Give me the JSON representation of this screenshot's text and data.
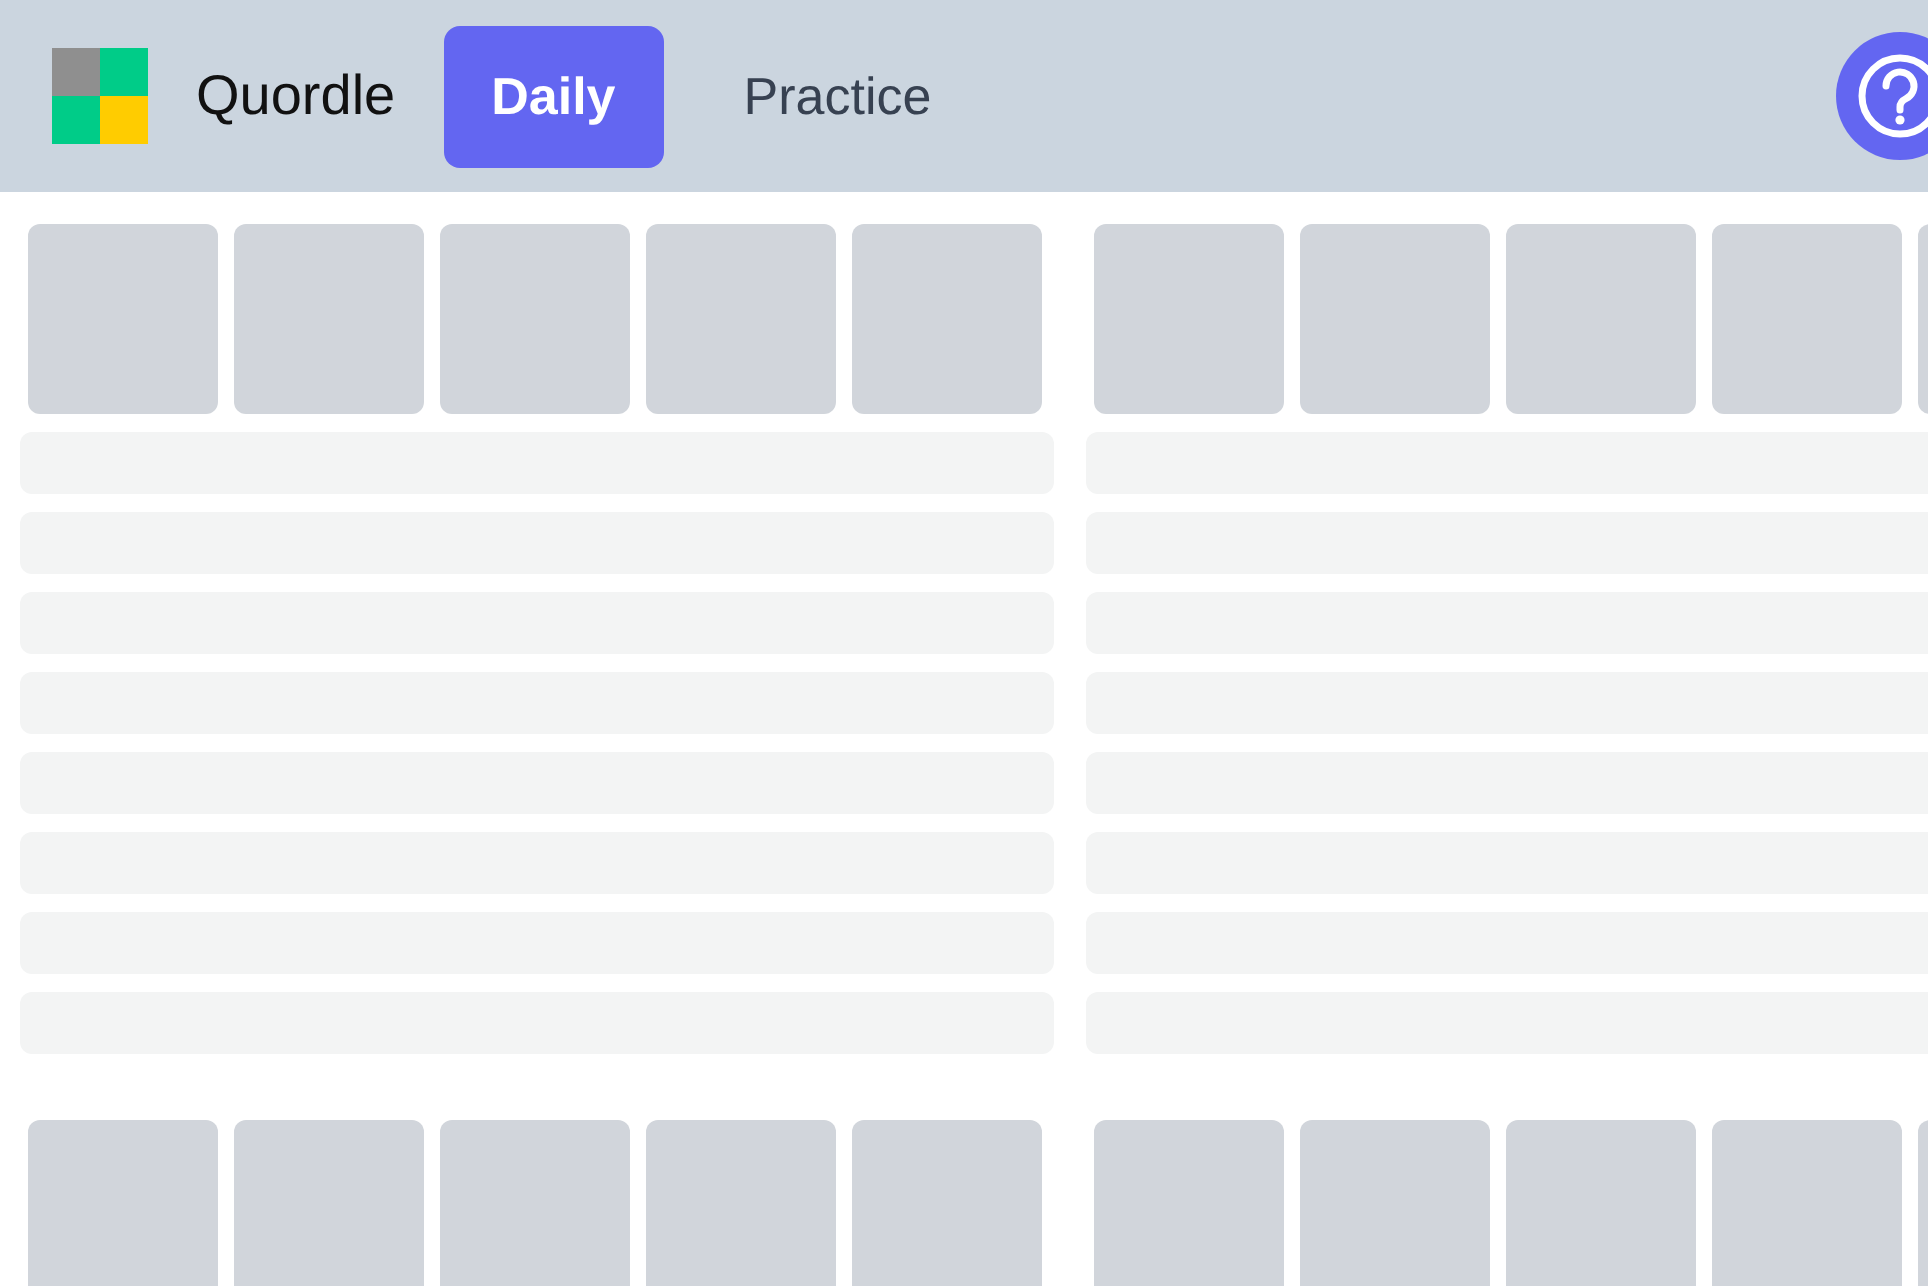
{
  "header": {
    "logo": {
      "kind": "grid"
    },
    "title": "Quordle",
    "tabs": [
      {
        "label": "Daily",
        "selected": true
      },
      {
        "label": "Practice",
        "selected": false
      }
    ],
    "help": {
      "kind": "question"
    }
  },
  "boards": [
    {
      "kind": "placeholder"
    },
    {
      "kind": "placeholder"
    },
    {
      "kind": "tiles-only"
    },
    {
      "kind": "tiles-only"
    }
  ]
}
